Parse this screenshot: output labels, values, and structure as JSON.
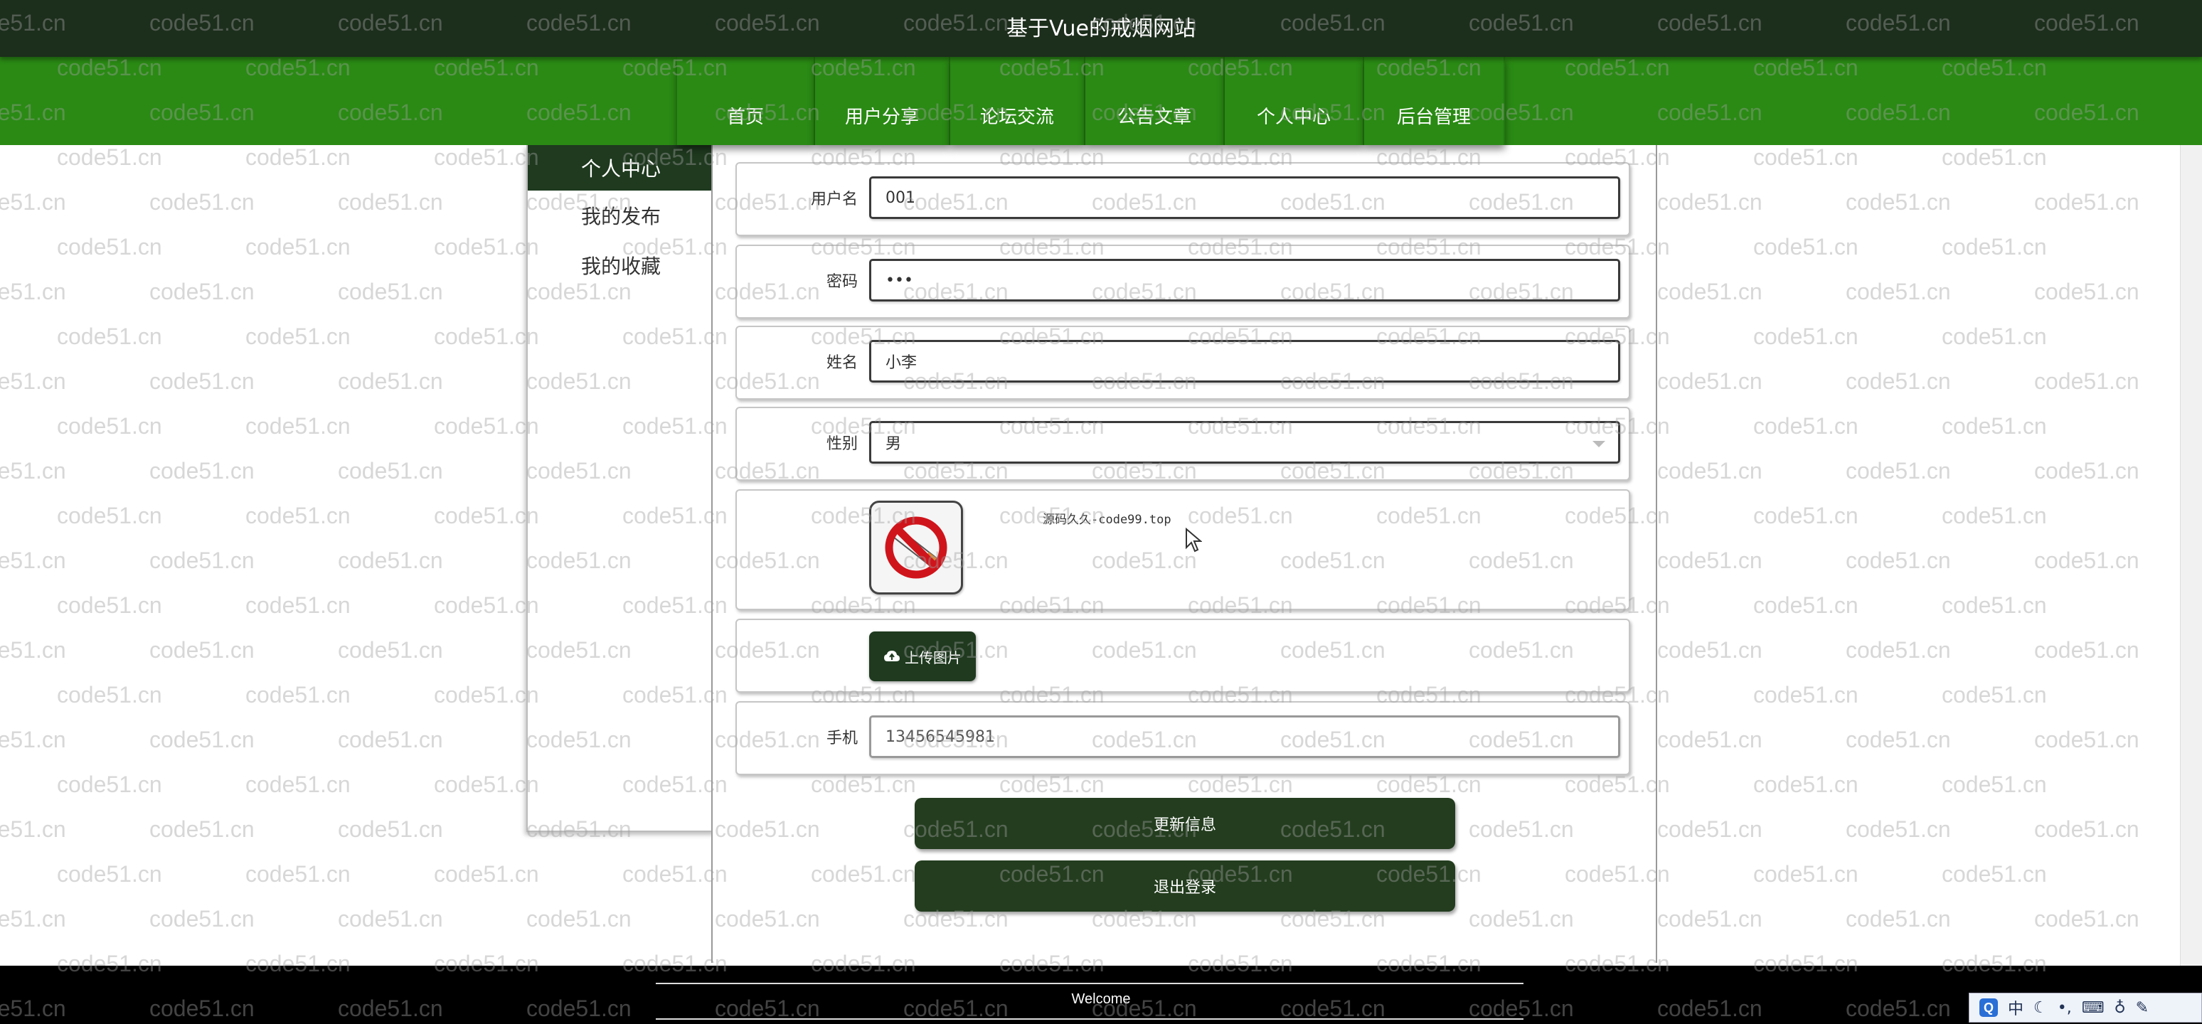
{
  "header": {
    "title": "基于Vue的戒烟网站"
  },
  "nav": {
    "items": [
      {
        "label": "首页"
      },
      {
        "label": "用户分享"
      },
      {
        "label": "论坛交流"
      },
      {
        "label": "公告文章"
      },
      {
        "label": "个人中心"
      },
      {
        "label": "后台管理"
      }
    ]
  },
  "sidebar": {
    "items": [
      {
        "label": "个人中心",
        "active": true
      },
      {
        "label": "我的发布",
        "active": false
      },
      {
        "label": "我的收藏",
        "active": false
      }
    ]
  },
  "form": {
    "username": {
      "label": "用户名",
      "value": "001"
    },
    "password": {
      "label": "密码",
      "value": "•••"
    },
    "name": {
      "label": "姓名",
      "value": "小李"
    },
    "gender": {
      "label": "性别",
      "value": "男"
    },
    "avatar": {
      "caption": "源码久久-code99.top",
      "icon": "no-smoking-icon"
    },
    "upload": {
      "label": "上传图片",
      "icon": "cloud-upload-icon"
    },
    "phone": {
      "label": "手机",
      "value": "13456545981"
    }
  },
  "buttons": {
    "update": "更新信息",
    "logout": "退出登录"
  },
  "footer": {
    "text": "Welcome"
  },
  "watermark": {
    "text": "code51.cn"
  },
  "ime": {
    "lang": "中"
  },
  "colors": {
    "titlebar": "#1c2e1c",
    "nav": "#2a8a14",
    "button": "#233d1e",
    "footer": "#000000"
  }
}
